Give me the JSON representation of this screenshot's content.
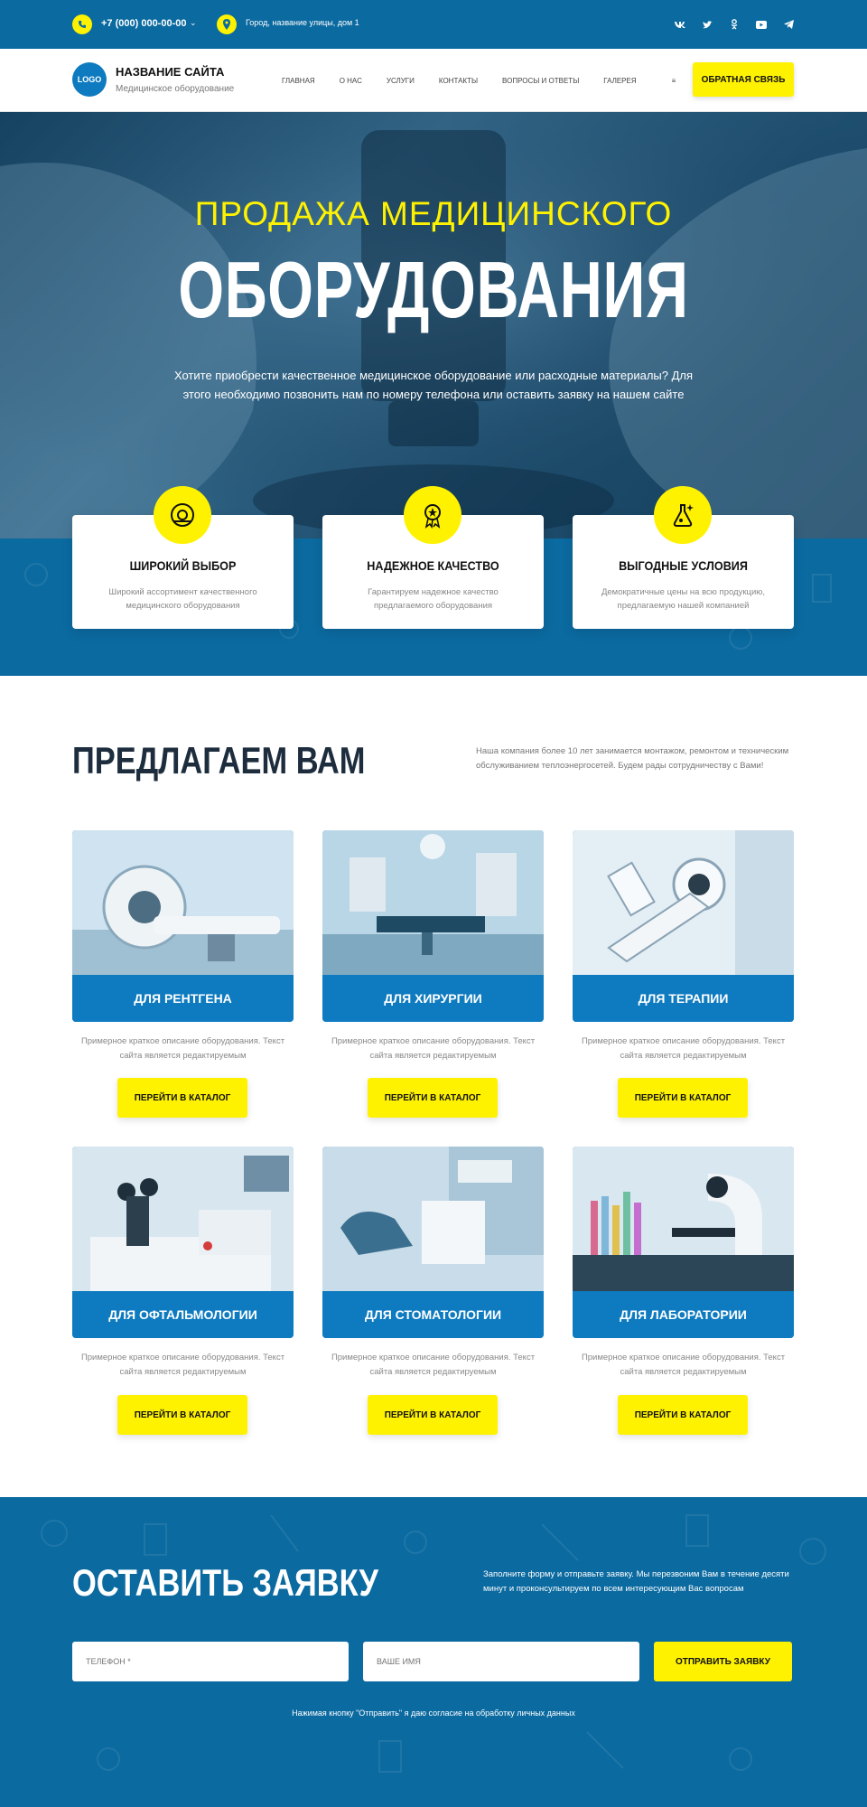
{
  "topbar": {
    "phone": "+7 (000) 000-00-00",
    "address": "Город, название улицы, дом 1",
    "socials": [
      "vk-icon",
      "twitter-icon",
      "odnoklassniki-icon",
      "youtube-icon",
      "telegram-icon"
    ]
  },
  "navbar": {
    "logo_text": "LOGO",
    "site_name": "НАЗВАНИЕ САЙТА",
    "site_desc": "Медицинское оборудование",
    "menu": [
      "ГЛАВНАЯ",
      "О НАС",
      "УСЛУГИ",
      "КОНТАКТЫ",
      "ВОПРОСЫ И ОТВЕТЫ",
      "ГАЛЕРЕЯ"
    ],
    "more_icon": "≡",
    "feedback_label": "ОБРАТНАЯ СВЯЗЬ"
  },
  "hero": {
    "subtitle": "ПРОДАЖА МЕДИЦИНСКОГО",
    "title": "ОБОРУДОВАНИЯ",
    "description": "Хотите приобрести качественное медицинское оборудование или расходные материалы? Для этого необходимо позвонить нам по номеру телефона или оставить заявку на нашем сайте"
  },
  "features": [
    {
      "title": "ШИРОКИЙ ВЫБОР",
      "desc": "Широкий ассортимент качественного медицинского оборудования",
      "icon": "mri-icon"
    },
    {
      "title": "НАДЕЖНОЕ КАЧЕСТВО",
      "desc": "Гарантируем надежное качество предлагаемого оборудования",
      "icon": "award-icon"
    },
    {
      "title": "ВЫГОДНЫЕ УСЛОВИЯ",
      "desc": "Демократичные цены на всю продукцию, предлагаемую нашей компанией",
      "icon": "flask-icon"
    }
  ],
  "offer": {
    "title": "ПРЕДЛАГАЕМ ВАМ",
    "desc": "Наша компания более 10 лет занимается монтажом, ремонтом и техническим обслуживанием теплоэнергосетей. Будем рады сотрудничеству с Вами!"
  },
  "cards": [
    {
      "label": "ДЛЯ РЕНТГЕНА",
      "desc": "Примерное краткое описание оборудования. Текст сайта является редактируемым",
      "button": "ПЕРЕЙТИ В КАТАЛОГ"
    },
    {
      "label": "ДЛЯ ХИРУРГИИ",
      "desc": "Примерное краткое описание оборудования. Текст сайта является редактируемым",
      "button": "ПЕРЕЙТИ В КАТАЛОГ"
    },
    {
      "label": "ДЛЯ ТЕРАПИИ",
      "desc": "Примерное краткое описание оборудования. Текст сайта является редактируемым",
      "button": "ПЕРЕЙТИ В КАТАЛОГ"
    },
    {
      "label": "ДЛЯ ОФТАЛЬМОЛОГИИ",
      "desc": "Примерное краткое описание оборудования. Текст сайта является редактируемым",
      "button": "ПЕРЕЙТИ В КАТАЛОГ"
    },
    {
      "label": "ДЛЯ СТОМАТОЛОГИИ",
      "desc": "Примерное краткое описание оборудования. Текст сайта является редактируемым",
      "button": "ПЕРЕЙТИ В КАТАЛОГ"
    },
    {
      "label": "ДЛЯ ЛАБОРАТОРИИ",
      "desc": "Примерное краткое описание оборудования. Текст сайта является редактируемым",
      "button": "ПЕРЕЙТИ В КАТАЛОГ"
    }
  ],
  "request": {
    "title": "ОСТАВИТЬ ЗАЯВКУ",
    "desc": "Заполните форму и отправьте заявку. Мы перезвоним Вам в течение десяти минут и проконсультируем по всем интересующим Вас вопросам",
    "phone_placeholder": "ТЕЛЕФОН *",
    "name_placeholder": "ВАШЕ ИМЯ",
    "submit_label": "ОТПРАВИТЬ ЗАЯВКУ",
    "consent": "Нажимая кнопку \"Отправить\" я даю согласие на обработку личных данных"
  },
  "colors": {
    "primary": "#0b6aa0",
    "accent": "#fff200",
    "card": "#0e7bc0",
    "dark": "#1d2d3d"
  }
}
